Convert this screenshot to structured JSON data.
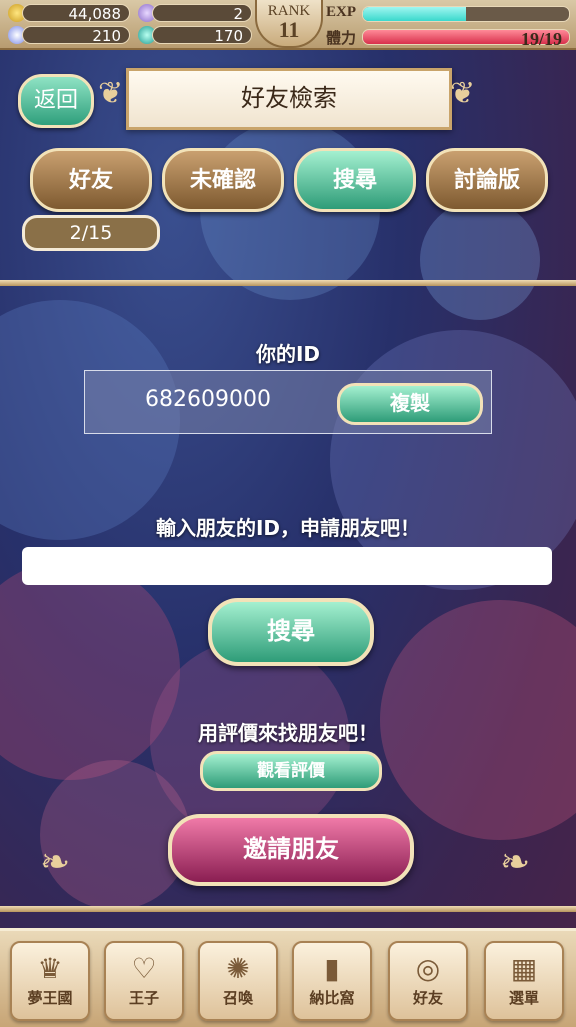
{
  "status": {
    "gold": "44,088",
    "tickets": "2",
    "crystals": "210",
    "orbs": "170",
    "rank_label": "RANK",
    "rank_value": "11",
    "exp_label": "EXP",
    "exp_fraction": 0.5,
    "stamina_label": "體力",
    "stamina_text": "19/19",
    "stamina_fraction": 1.0
  },
  "header": {
    "back_label": "返回",
    "title": "好友檢索"
  },
  "tabs": [
    {
      "label": "好友"
    },
    {
      "label": "未確認"
    },
    {
      "label": "搜尋"
    },
    {
      "label": "討論版"
    }
  ],
  "page_count": "2/15",
  "id_section": {
    "label": "你的ID",
    "id_value": "682609000",
    "copy_label": "複製"
  },
  "search_section": {
    "prompt": "輸入朋友的ID，申請朋友吧！",
    "input_value": "",
    "search_label": "搜尋"
  },
  "review_section": {
    "prompt": "用評價來找朋友吧！",
    "view_label": "觀看評價"
  },
  "invite_label": "邀請朋友",
  "nav": [
    {
      "label": "夢王國",
      "icon": "crown-icon"
    },
    {
      "label": "王子",
      "icon": "heart-icon"
    },
    {
      "label": "召喚",
      "icon": "sun-icon"
    },
    {
      "label": "納比窩",
      "icon": "door-icon"
    },
    {
      "label": "好友",
      "icon": "ring-icon"
    },
    {
      "label": "選單",
      "icon": "grid-icon"
    }
  ],
  "colors": {
    "accent_green": "#2e9c78",
    "accent_pink": "#8a1e52",
    "gold_frame": "#f2e2b8",
    "exp_bar": "#4fe0d8",
    "stamina_bar": "#e8405a"
  }
}
